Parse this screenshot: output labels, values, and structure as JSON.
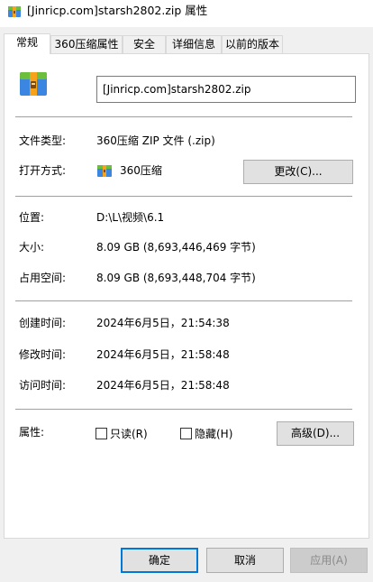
{
  "window": {
    "title": "[Jinricp.com]starsh2802.zip 属性"
  },
  "tabs": [
    {
      "label": "常规",
      "active": true
    },
    {
      "label": "360压缩属性",
      "active": false
    },
    {
      "label": "安全",
      "active": false
    },
    {
      "label": "详细信息",
      "active": false
    },
    {
      "label": "以前的版本",
      "active": false
    }
  ],
  "general": {
    "file_name": "[Jinricp.com]starsh2802.zip",
    "type_label": "文件类型:",
    "type_value": "360压缩 ZIP 文件 (.zip)",
    "open_with_label": "打开方式:",
    "open_with_value": "360压缩",
    "change_button": "更改(C)...",
    "location_label": "位置:",
    "location_value": "D:\\L\\视频\\6.1",
    "size_label": "大小:",
    "size_value": "8.09 GB (8,693,446,469 字节)",
    "disk_size_label": "占用空间:",
    "disk_size_value": "8.09 GB (8,693,448,704 字节)",
    "created_label": "创建时间:",
    "created_value": "2024年6月5日，21:54:38",
    "modified_label": "修改时间:",
    "modified_value": "2024年6月5日，21:58:48",
    "accessed_label": "访问时间:",
    "accessed_value": "2024年6月5日，21:58:48",
    "attributes_label": "属性:",
    "readonly_label": "只读(R)",
    "readonly_checked": false,
    "hidden_label": "隐藏(H)",
    "hidden_checked": false,
    "advanced_button": "高级(D)..."
  },
  "footer": {
    "ok_button": "确定",
    "cancel_button": "取消",
    "apply_button": "应用(A)"
  },
  "icons": {
    "title": "zip-archive-icon",
    "file": "zip-archive-icon",
    "app": "360-compress-icon"
  },
  "colors": {
    "accent": "#0078d7",
    "zip_blue": "#3b86e0",
    "zip_orange": "#f7a21b",
    "zip_green": "#6cbf3c"
  }
}
